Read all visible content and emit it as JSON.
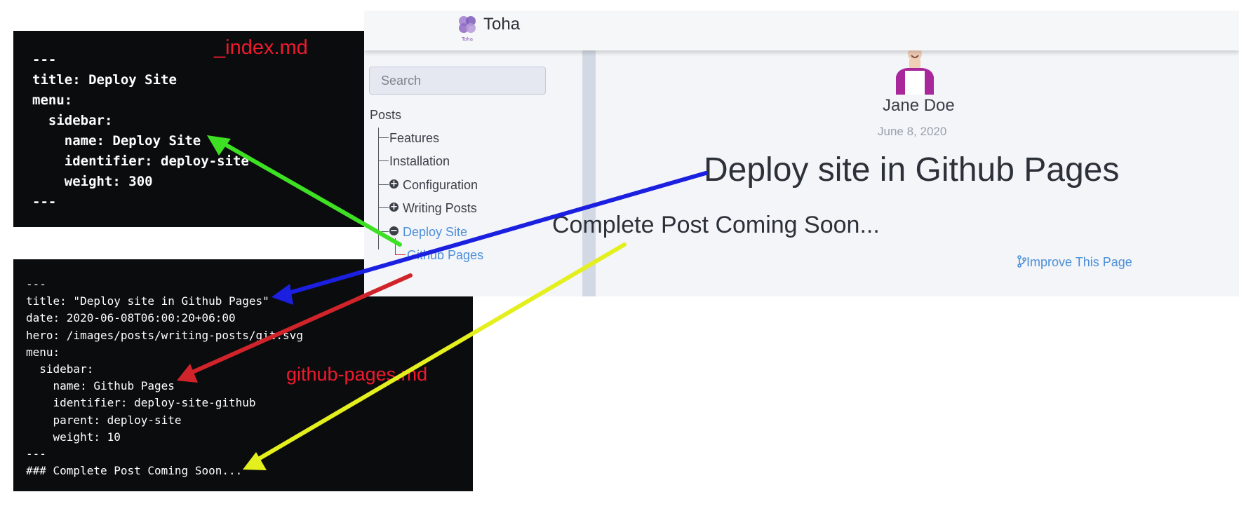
{
  "index_file": {
    "label": "_index.md",
    "code": "---\ntitle: Deploy Site\nmenu:\n  sidebar:\n    name: Deploy Site\n    identifier: deploy-site\n    weight: 300\n---"
  },
  "github_file": {
    "label": "github-pages.md",
    "code": "---\ntitle: \"Deploy site in Github Pages\"\ndate: 2020-06-08T06:00:20+06:00\nhero: /images/posts/writing-posts/git.svg\nmenu:\n  sidebar:\n    name: Github Pages\n    identifier: deploy-site-github\n    parent: deploy-site\n    weight: 10\n---\n### Complete Post Coming Soon..."
  },
  "site": {
    "brand": "Toha",
    "logo_text": "Toha",
    "search": {
      "placeholder": "Search",
      "value": ""
    },
    "sidebar": {
      "root": "Posts",
      "items": [
        {
          "label": "Features"
        },
        {
          "label": "Installation"
        },
        {
          "label": "Configuration",
          "toggle": "plus"
        },
        {
          "label": "Writing Posts",
          "toggle": "plus"
        },
        {
          "label": "Deploy Site",
          "toggle": "minus",
          "active": true
        },
        {
          "label": "Github Pages",
          "active": true
        }
      ]
    },
    "post": {
      "author": "Jane Doe",
      "date": "June 8, 2020",
      "title": "Deploy site in Github Pages",
      "heading": "Complete Post Coming Soon...",
      "improve_link": "Improve This Page"
    }
  },
  "colors": {
    "code_bg": "#0b0c0e",
    "label_red": "#ef1a2e",
    "link_blue": "#4d8fd8",
    "arrow_green": "#3ee024",
    "arrow_blue": "#1b1fe0",
    "arrow_red": "#d1242a",
    "arrow_yellow": "#e4ef1e"
  }
}
